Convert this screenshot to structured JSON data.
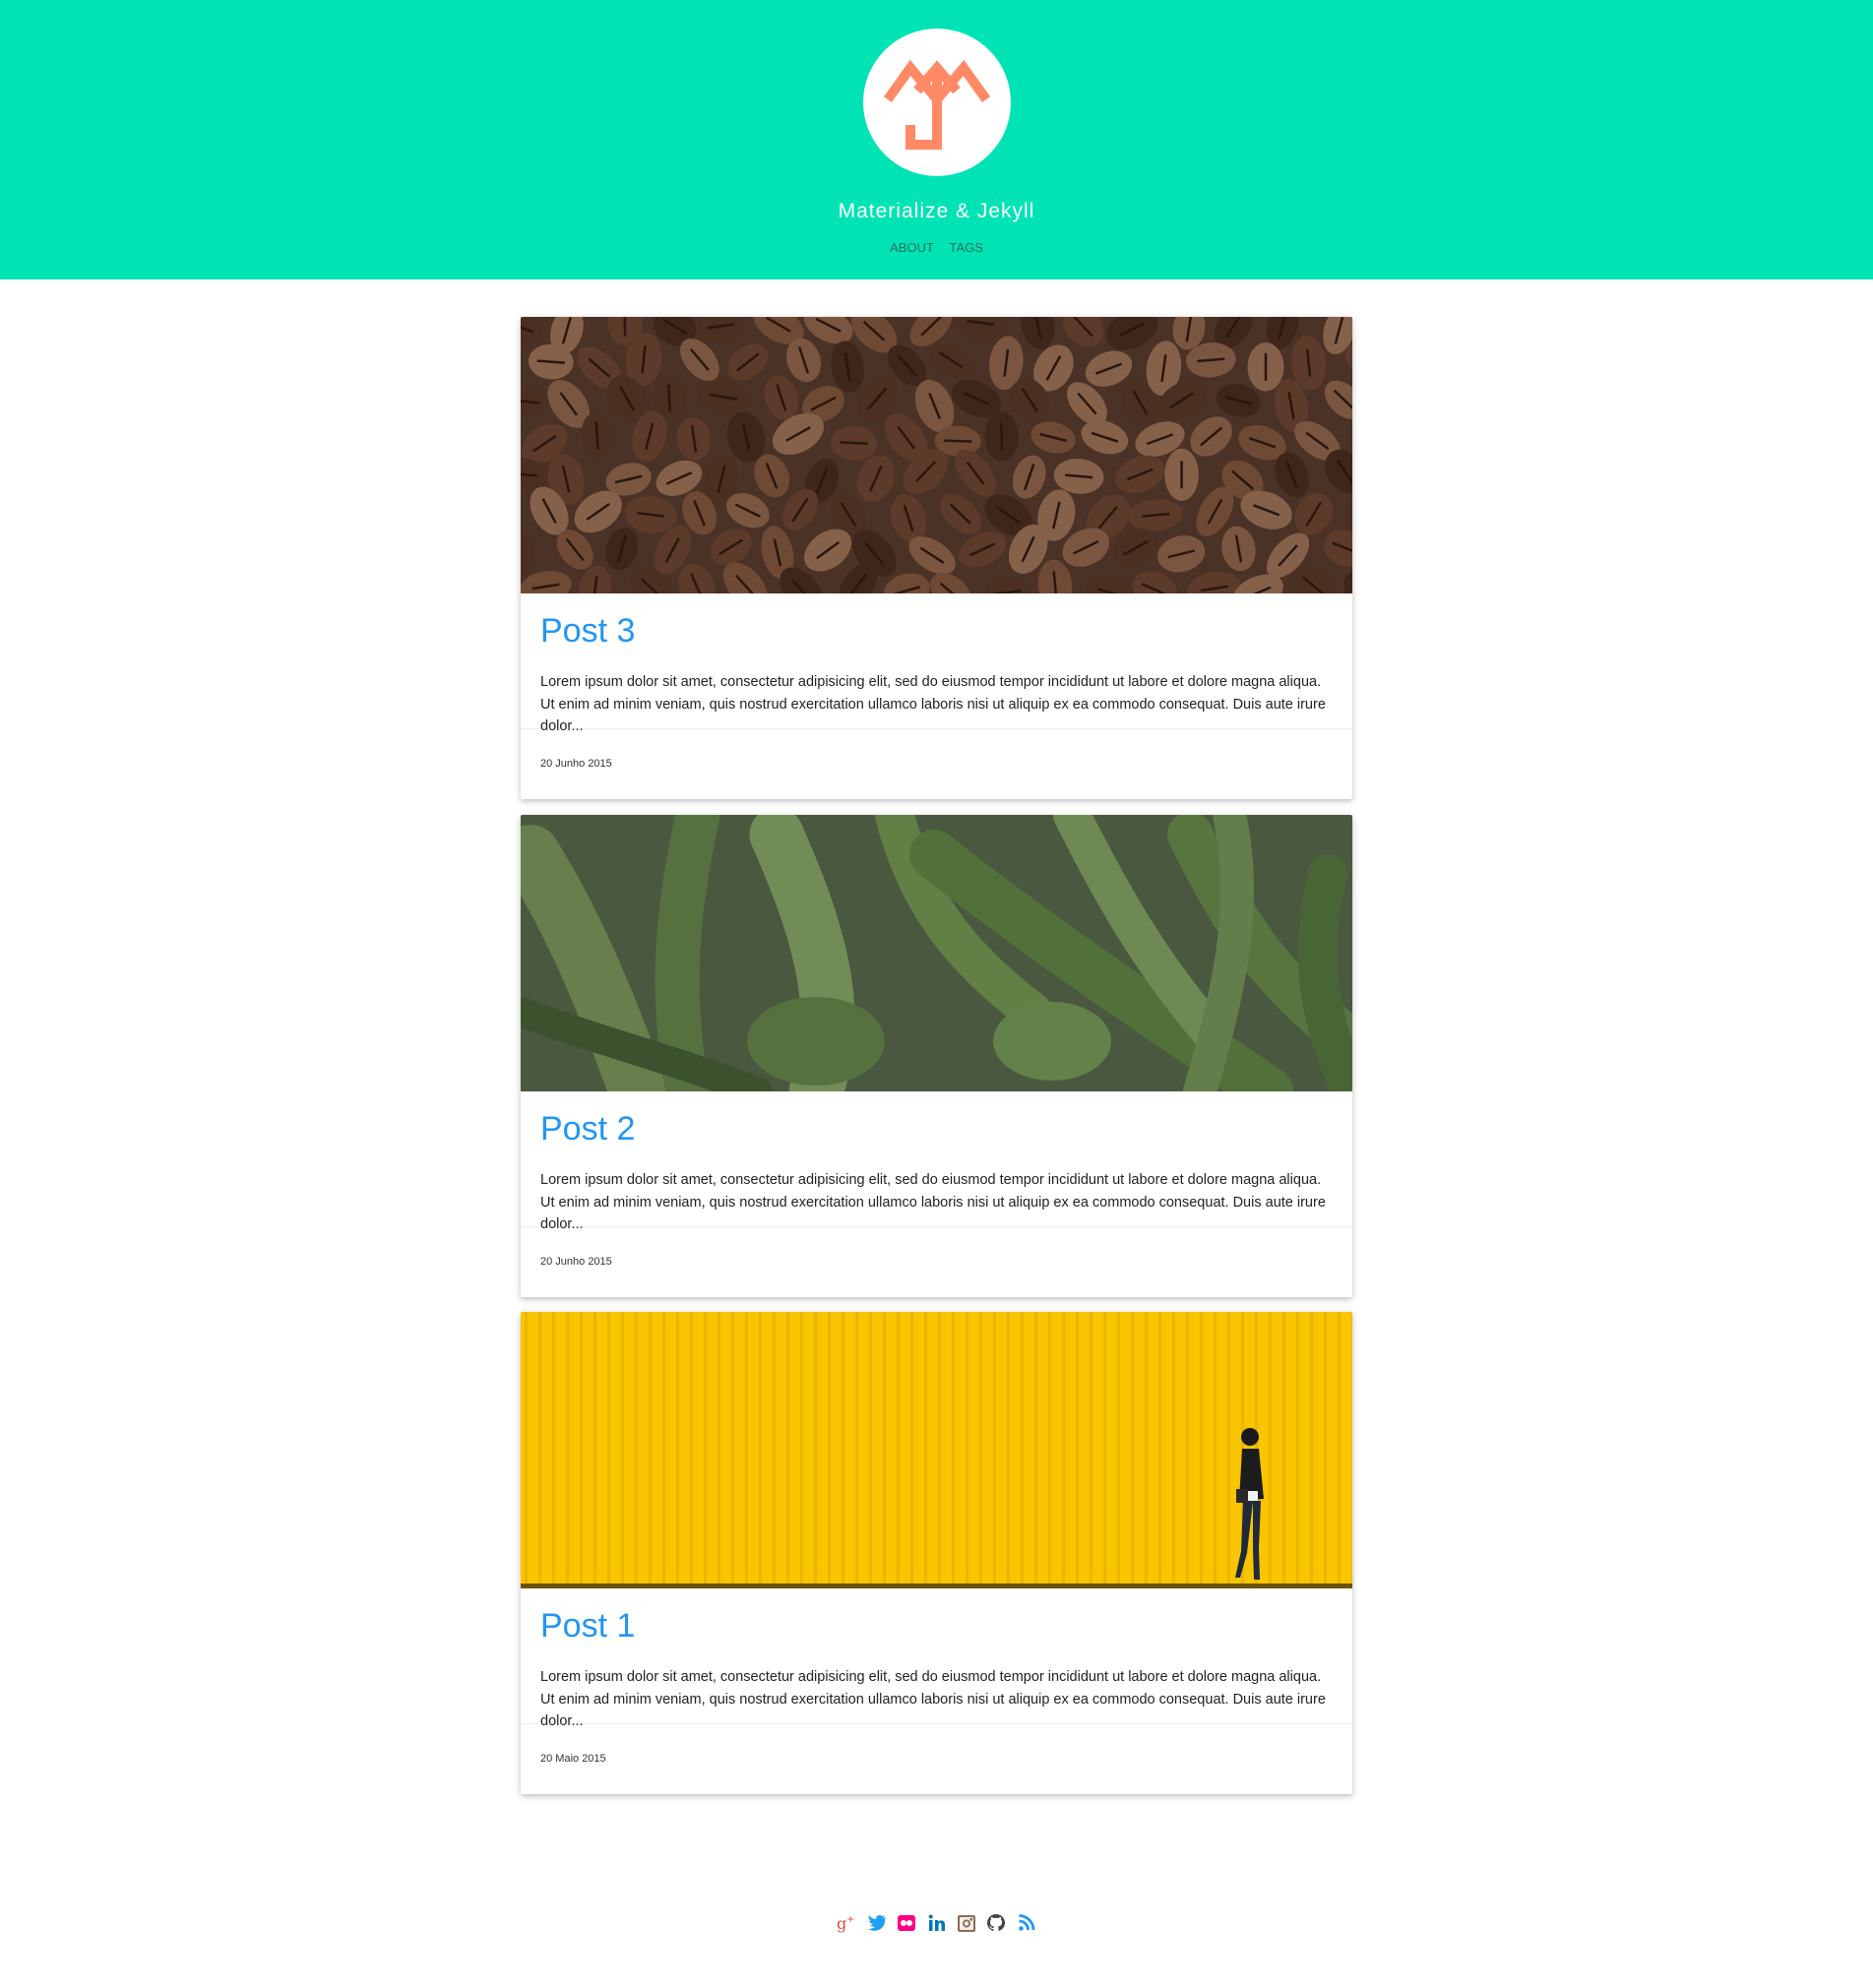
{
  "site": {
    "title": "Materialize & Jekyll",
    "logo_icon": "mj-logo-icon"
  },
  "nav": {
    "items": [
      {
        "label": "ABOUT"
      },
      {
        "label": "TAGS"
      }
    ]
  },
  "posts": [
    {
      "title": "Post 3",
      "excerpt": "Lorem ipsum dolor sit amet, consectetur adipisicing elit, sed do eiusmod tempor incididunt ut labore et dolore magna aliqua. Ut enim ad minim veniam, quis nostrud exercitation ullamco laboris nisi ut aliquip ex ea commodo consequat. Duis aute irure dolor...",
      "date": "20 Junho 2015",
      "image": "coffee-beans-photo"
    },
    {
      "title": "Post 2",
      "excerpt": "Lorem ipsum dolor sit amet, consectetur adipisicing elit, sed do eiusmod tempor incididunt ut labore et dolore magna aliqua. Ut enim ad minim veniam, quis nostrud exercitation ullamco laboris nisi ut aliquip ex ea commodo consequat. Duis aute irure dolor...",
      "date": "20 Junho 2015",
      "image": "green-okra-photo"
    },
    {
      "title": "Post 1",
      "excerpt": "Lorem ipsum dolor sit amet, consectetur adipisicing elit, sed do eiusmod tempor incididunt ut labore et dolore magna aliqua. Ut enim ad minim veniam, quis nostrud exercitation ullamco laboris nisi ut aliquip ex ea commodo consequat. Duis aute irure dolor...",
      "date": "20 Maio 2015",
      "image": "yellow-wall-woman-photo"
    }
  ],
  "social": {
    "icons": [
      "google-plus-icon",
      "twitter-icon",
      "flickr-icon",
      "linkedin-icon",
      "instagram-icon",
      "github-icon",
      "rss-icon"
    ]
  },
  "colors": {
    "header_bg": "#00e3b5",
    "logo_mark": "#ff8a65",
    "post_title": "#2196f3",
    "nav_text": "#2a6f60"
  }
}
